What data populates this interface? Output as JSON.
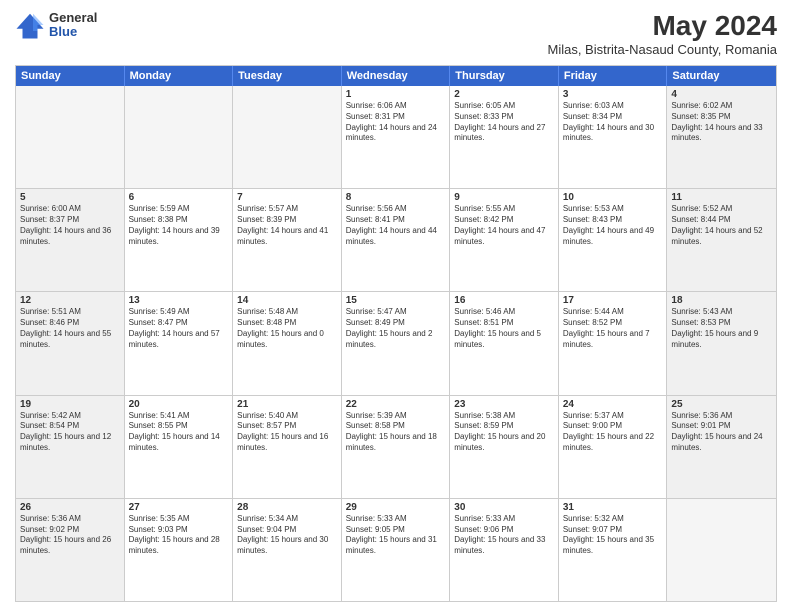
{
  "header": {
    "logo_general": "General",
    "logo_blue": "Blue",
    "month_title": "May 2024",
    "subtitle": "Milas, Bistrita-Nasaud County, Romania"
  },
  "days_of_week": [
    "Sunday",
    "Monday",
    "Tuesday",
    "Wednesday",
    "Thursday",
    "Friday",
    "Saturday"
  ],
  "rows": [
    [
      {
        "day": "",
        "text": "",
        "empty": true
      },
      {
        "day": "",
        "text": "",
        "empty": true
      },
      {
        "day": "",
        "text": "",
        "empty": true
      },
      {
        "day": "1",
        "text": "Sunrise: 6:06 AM\nSunset: 8:31 PM\nDaylight: 14 hours and 24 minutes."
      },
      {
        "day": "2",
        "text": "Sunrise: 6:05 AM\nSunset: 8:33 PM\nDaylight: 14 hours and 27 minutes."
      },
      {
        "day": "3",
        "text": "Sunrise: 6:03 AM\nSunset: 8:34 PM\nDaylight: 14 hours and 30 minutes."
      },
      {
        "day": "4",
        "text": "Sunrise: 6:02 AM\nSunset: 8:35 PM\nDaylight: 14 hours and 33 minutes.",
        "shaded": true
      }
    ],
    [
      {
        "day": "5",
        "text": "Sunrise: 6:00 AM\nSunset: 8:37 PM\nDaylight: 14 hours and 36 minutes.",
        "shaded": true
      },
      {
        "day": "6",
        "text": "Sunrise: 5:59 AM\nSunset: 8:38 PM\nDaylight: 14 hours and 39 minutes."
      },
      {
        "day": "7",
        "text": "Sunrise: 5:57 AM\nSunset: 8:39 PM\nDaylight: 14 hours and 41 minutes."
      },
      {
        "day": "8",
        "text": "Sunrise: 5:56 AM\nSunset: 8:41 PM\nDaylight: 14 hours and 44 minutes."
      },
      {
        "day": "9",
        "text": "Sunrise: 5:55 AM\nSunset: 8:42 PM\nDaylight: 14 hours and 47 minutes."
      },
      {
        "day": "10",
        "text": "Sunrise: 5:53 AM\nSunset: 8:43 PM\nDaylight: 14 hours and 49 minutes."
      },
      {
        "day": "11",
        "text": "Sunrise: 5:52 AM\nSunset: 8:44 PM\nDaylight: 14 hours and 52 minutes.",
        "shaded": true
      }
    ],
    [
      {
        "day": "12",
        "text": "Sunrise: 5:51 AM\nSunset: 8:46 PM\nDaylight: 14 hours and 55 minutes.",
        "shaded": true
      },
      {
        "day": "13",
        "text": "Sunrise: 5:49 AM\nSunset: 8:47 PM\nDaylight: 14 hours and 57 minutes."
      },
      {
        "day": "14",
        "text": "Sunrise: 5:48 AM\nSunset: 8:48 PM\nDaylight: 15 hours and 0 minutes."
      },
      {
        "day": "15",
        "text": "Sunrise: 5:47 AM\nSunset: 8:49 PM\nDaylight: 15 hours and 2 minutes."
      },
      {
        "day": "16",
        "text": "Sunrise: 5:46 AM\nSunset: 8:51 PM\nDaylight: 15 hours and 5 minutes."
      },
      {
        "day": "17",
        "text": "Sunrise: 5:44 AM\nSunset: 8:52 PM\nDaylight: 15 hours and 7 minutes."
      },
      {
        "day": "18",
        "text": "Sunrise: 5:43 AM\nSunset: 8:53 PM\nDaylight: 15 hours and 9 minutes.",
        "shaded": true
      }
    ],
    [
      {
        "day": "19",
        "text": "Sunrise: 5:42 AM\nSunset: 8:54 PM\nDaylight: 15 hours and 12 minutes.",
        "shaded": true
      },
      {
        "day": "20",
        "text": "Sunrise: 5:41 AM\nSunset: 8:55 PM\nDaylight: 15 hours and 14 minutes."
      },
      {
        "day": "21",
        "text": "Sunrise: 5:40 AM\nSunset: 8:57 PM\nDaylight: 15 hours and 16 minutes."
      },
      {
        "day": "22",
        "text": "Sunrise: 5:39 AM\nSunset: 8:58 PM\nDaylight: 15 hours and 18 minutes."
      },
      {
        "day": "23",
        "text": "Sunrise: 5:38 AM\nSunset: 8:59 PM\nDaylight: 15 hours and 20 minutes."
      },
      {
        "day": "24",
        "text": "Sunrise: 5:37 AM\nSunset: 9:00 PM\nDaylight: 15 hours and 22 minutes."
      },
      {
        "day": "25",
        "text": "Sunrise: 5:36 AM\nSunset: 9:01 PM\nDaylight: 15 hours and 24 minutes.",
        "shaded": true
      }
    ],
    [
      {
        "day": "26",
        "text": "Sunrise: 5:36 AM\nSunset: 9:02 PM\nDaylight: 15 hours and 26 minutes.",
        "shaded": true
      },
      {
        "day": "27",
        "text": "Sunrise: 5:35 AM\nSunset: 9:03 PM\nDaylight: 15 hours and 28 minutes."
      },
      {
        "day": "28",
        "text": "Sunrise: 5:34 AM\nSunset: 9:04 PM\nDaylight: 15 hours and 30 minutes."
      },
      {
        "day": "29",
        "text": "Sunrise: 5:33 AM\nSunset: 9:05 PM\nDaylight: 15 hours and 31 minutes."
      },
      {
        "day": "30",
        "text": "Sunrise: 5:33 AM\nSunset: 9:06 PM\nDaylight: 15 hours and 33 minutes."
      },
      {
        "day": "31",
        "text": "Sunrise: 5:32 AM\nSunset: 9:07 PM\nDaylight: 15 hours and 35 minutes."
      },
      {
        "day": "",
        "text": "",
        "empty": true
      }
    ]
  ]
}
